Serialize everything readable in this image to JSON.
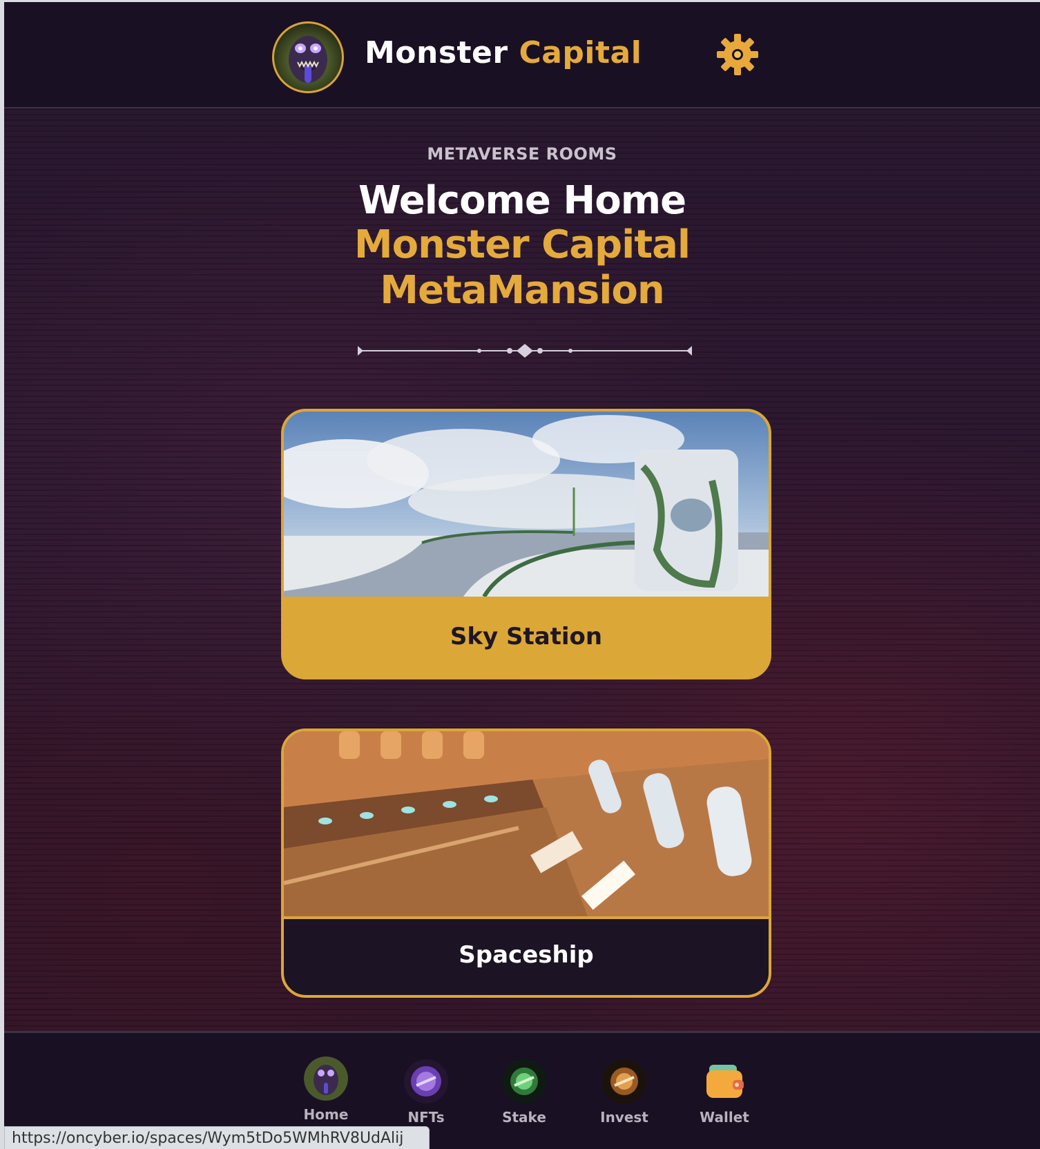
{
  "header": {
    "brand_first": "Monster",
    "brand_second": "Capital",
    "logo_icon": "monster-avatar-icon",
    "settings_icon": "gear-icon"
  },
  "hero": {
    "eyebrow": "METAVERSE ROOMS",
    "title_line1": "Welcome Home",
    "title_line2": "Monster Capital",
    "title_line3": "MetaMansion"
  },
  "rooms": [
    {
      "label": "Sky Station",
      "image": "sky-station-image"
    },
    {
      "label": "Spaceship",
      "image": "spaceship-image"
    }
  ],
  "nav": {
    "items": [
      {
        "label": "Home",
        "icon": "monster-avatar-icon"
      },
      {
        "label": "NFTs",
        "icon": "nft-orb-icon"
      },
      {
        "label": "Stake",
        "icon": "stake-orb-icon"
      },
      {
        "label": "Invest",
        "icon": "invest-orb-icon"
      },
      {
        "label": "Wallet",
        "icon": "wallet-icon"
      }
    ]
  },
  "status": {
    "url": "https://oncyber.io/spaces/Wym5tDo5WMhRV8UdAlij"
  },
  "colors": {
    "accent": "#e4aa3b",
    "background": "#1a1024",
    "card_gold": "#dba737"
  }
}
